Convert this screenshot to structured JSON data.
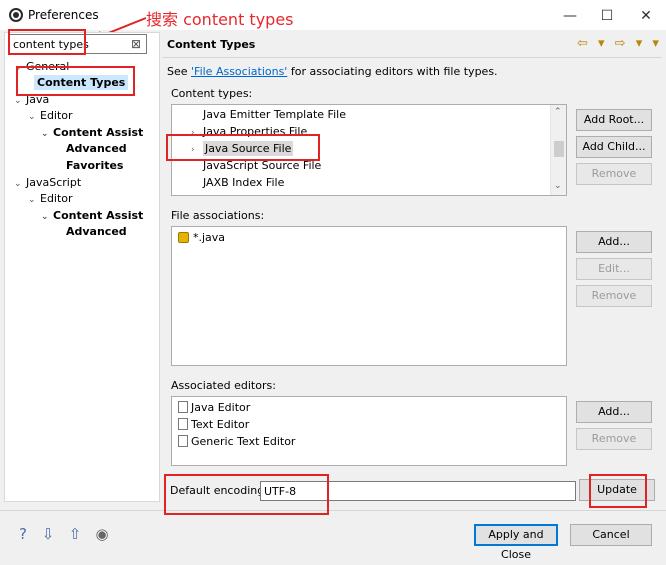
{
  "window": {
    "title": "Preferences",
    "minimize": "—",
    "maximize": "☐",
    "close": "✕"
  },
  "annotation": {
    "text": "搜索 content types"
  },
  "search": {
    "value": "content types",
    "clear": "⊠"
  },
  "tree": [
    {
      "label": "General",
      "toggle": "⌄"
    },
    {
      "label": "Content Types",
      "toggle": ""
    },
    {
      "label": "Java",
      "toggle": "⌄"
    },
    {
      "label": "Editor",
      "toggle": "⌄"
    },
    {
      "label": "Content Assist",
      "toggle": "⌄"
    },
    {
      "label": "Advanced",
      "toggle": ""
    },
    {
      "label": "Favorites",
      "toggle": ""
    },
    {
      "label": "JavaScript",
      "toggle": "⌄"
    },
    {
      "label": "Editor",
      "toggle": "⌄"
    },
    {
      "label": "Content Assist",
      "toggle": "⌄"
    },
    {
      "label": "Advanced",
      "toggle": ""
    }
  ],
  "header": {
    "title": "Content Types",
    "nav": "⇦ ▾ ⇨ ▾ ▾"
  },
  "description": {
    "prefix": "See ",
    "link": "'File Associations'",
    "suffix": " for associating editors with file types."
  },
  "content_types": {
    "label": "Content types:",
    "items": [
      {
        "label": "Java Emitter Template File",
        "toggle": ""
      },
      {
        "label": "Java Properties File",
        "toggle": "›"
      },
      {
        "label": "Java Source File",
        "toggle": "›"
      },
      {
        "label": "JavaScript Source File",
        "toggle": ""
      },
      {
        "label": "JAXB Index File",
        "toggle": ""
      }
    ],
    "buttons": {
      "add_root": "Add Root...",
      "add_child": "Add Child...",
      "remove": "Remove"
    }
  },
  "file_associations": {
    "label": "File associations:",
    "items": [
      "*.java"
    ],
    "buttons": {
      "add": "Add...",
      "edit": "Edit...",
      "remove": "Remove"
    }
  },
  "associated_editors": {
    "label": "Associated editors:",
    "items": [
      "Java Editor",
      "Text Editor",
      "Generic Text Editor"
    ],
    "buttons": {
      "add": "Add...",
      "remove": "Remove"
    }
  },
  "encoding": {
    "label": "Default encoding:",
    "value": "UTF-8",
    "update": "Update"
  },
  "footer": {
    "apply_close": "Apply and Close",
    "cancel": "Cancel",
    "icons": [
      "help-icon",
      "import-icon",
      "export-icon",
      "record-icon"
    ]
  }
}
